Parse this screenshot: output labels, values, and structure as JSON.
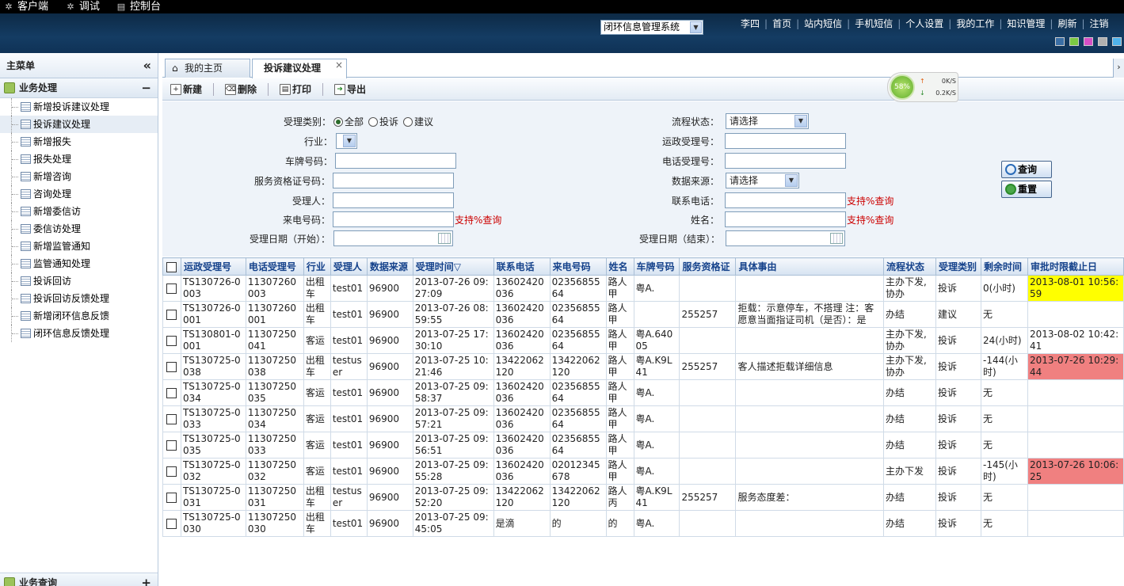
{
  "topbar": {
    "items": [
      {
        "label": "客户端",
        "icon": "client-icon"
      },
      {
        "label": "调试",
        "icon": "debug-icon"
      },
      {
        "label": "控制台",
        "icon": "console-icon"
      }
    ]
  },
  "header": {
    "system_select": "闭环信息管理系统",
    "nav": [
      "李四",
      "首页",
      "站内短信",
      "手机短信",
      "个人设置",
      "我的工作",
      "知识管理",
      "刷新",
      "注销"
    ],
    "theme_colors": [
      "#3a6ea5",
      "#7ac943",
      "#d64fc5",
      "#b0b0b0",
      "#4fb3ec"
    ]
  },
  "sidebar": {
    "title": "主菜单",
    "group": "业务处理",
    "items": [
      "新增投诉建议处理",
      "投诉建议处理",
      "新增报失",
      "报失处理",
      "新增咨询",
      "咨询处理",
      "新增委信访",
      "委信访处理",
      "新增监管通知",
      "监管通知处理",
      "投诉回访",
      "投诉回访反馈处理",
      "新增闭环信息反馈",
      "闭环信息反馈处理"
    ],
    "active_index": 1,
    "group2": "业务查询"
  },
  "tabs": [
    {
      "label": "我的主页"
    },
    {
      "label": "投诉建议处理"
    }
  ],
  "toolbar": {
    "new": "新建",
    "delete": "删除",
    "print": "打印",
    "export": "导出"
  },
  "form": {
    "type_label": "受理类别：",
    "type_options": [
      "全部",
      "投诉",
      "建议"
    ],
    "industry_label": "行业：",
    "plate_label": "车牌号码：",
    "cert_label": "服务资格证号码：",
    "handler_label": "受理人：",
    "caller_label": "来电号码：",
    "start_date_label": "受理日期（开始）：",
    "flow_label": "流程状态：",
    "flow_value": "请选择",
    "yz_label": "运政受理号：",
    "phone_no_label": "电话受理号：",
    "source_label": "数据来源：",
    "source_value": "请选择",
    "contact_label": "联系电话：",
    "name_label": "姓名：",
    "end_date_label": "受理日期（结束）：",
    "hint": "支持%查询",
    "query_btn": "查询",
    "reset_btn": "重置"
  },
  "netmon": {
    "percent": "58%",
    "up": "0K/S",
    "down": "0.2K/S"
  },
  "table": {
    "columns": [
      "运政受理号",
      "电话受理号",
      "行业",
      "受理人",
      "数据来源",
      "受理时间▽",
      "联系电话",
      "来电号码",
      "姓名",
      "车牌号码",
      "服务资格证",
      "具体事由",
      "流程状态",
      "受理类别",
      "剩余时间",
      "审批时限截止日"
    ],
    "rows": [
      [
        "TS130726-0003",
        "11307260003",
        "出租车",
        "test01",
        "96900",
        "2013-07-26 09:27:09",
        "13602420036",
        "0235685564",
        "路人甲",
        "粤A.",
        "",
        "",
        "主办下发,协办",
        "投诉",
        "0(小时)",
        "2013-08-01 10:56:59"
      ],
      [
        "TS130726-0001",
        "11307260001",
        "出租车",
        "test01",
        "96900",
        "2013-07-26 08:59:55",
        "13602420036",
        "0235685564",
        "路人甲",
        "",
        "255257",
        "拒载：示意停车，不搭理 注：客愿意当面指证司机（是否）：是",
        "办结",
        "建议",
        "无",
        ""
      ],
      [
        "TS130801-0001",
        "11307250041",
        "客运",
        "test01",
        "96900",
        "2013-07-25 17:30:10",
        "13602420036",
        "0235685564",
        "路人甲",
        "粤A.64005",
        "",
        "",
        "主办下发,协办",
        "投诉",
        "24(小时)",
        "2013-08-02 10:42:41"
      ],
      [
        "TS130725-0038",
        "11307250038",
        "出租车",
        "testuser",
        "96900",
        "2013-07-25 10:21:46",
        "13422062120",
        "13422062120",
        "路人甲",
        "粤A.K9L41",
        "255257",
        "客人描述拒载详细信息",
        "主办下发,协办",
        "投诉",
        "-144(小时)",
        "2013-07-26 10:29:44"
      ],
      [
        "TS130725-0034",
        "11307250035",
        "客运",
        "test01",
        "96900",
        "2013-07-25 09:58:37",
        "13602420036",
        "0235685564",
        "路人甲",
        "粤A.",
        "",
        "",
        "办结",
        "投诉",
        "无",
        ""
      ],
      [
        "TS130725-0033",
        "11307250034",
        "客运",
        "test01",
        "96900",
        "2013-07-25 09:57:21",
        "13602420036",
        "0235685564",
        "路人甲",
        "粤A.",
        "",
        "",
        "办结",
        "投诉",
        "无",
        ""
      ],
      [
        "TS130725-0035",
        "11307250033",
        "客运",
        "test01",
        "96900",
        "2013-07-25 09:56:51",
        "13602420036",
        "0235685564",
        "路人甲",
        "粤A.",
        "",
        "",
        "办结",
        "投诉",
        "无",
        ""
      ],
      [
        "TS130725-0032",
        "11307250032",
        "客运",
        "test01",
        "96900",
        "2013-07-25 09:55:28",
        "13602420036",
        "02012345678",
        "路人甲",
        "粤A.",
        "",
        "",
        "主办下发",
        "投诉",
        "-145(小时)",
        "2013-07-26 10:06:25"
      ],
      [
        "TS130725-0031",
        "11307250031",
        "出租车",
        "testuser",
        "96900",
        "2013-07-25 09:52:20",
        "13422062120",
        "13422062120",
        "路人丙",
        "粤A.K9L41",
        "255257",
        "服务态度差：",
        "办结",
        "投诉",
        "无",
        ""
      ],
      [
        "TS130725-0030",
        "11307250030",
        "出租车",
        "test01",
        "96900",
        "2013-07-25 09:45:05",
        "是滴",
        "的",
        "的",
        "粤A.",
        "",
        "",
        "办结",
        "投诉",
        "无",
        ""
      ]
    ],
    "row_highlight": [
      "yellow",
      "",
      "",
      "red",
      "",
      "",
      "",
      "red",
      "",
      ""
    ]
  }
}
